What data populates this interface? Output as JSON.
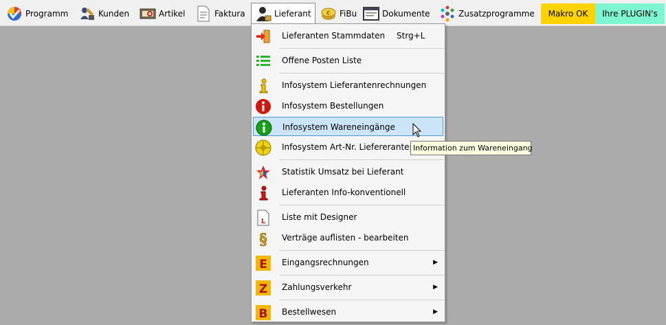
{
  "menubar": {
    "items": [
      {
        "label": "Programm",
        "icon": "colorful-checkmark-icon"
      },
      {
        "label": "Kunden",
        "icon": "customers-tools-icon"
      },
      {
        "label": "Artikel",
        "icon": "article-box-icon"
      },
      {
        "label": "Faktura",
        "icon": "invoice-document-icon"
      },
      {
        "label": "Lieferant",
        "icon": "supplier-person-icon"
      },
      {
        "label": "FiBu",
        "icon": "euro-coin-icon"
      },
      {
        "label": "Dokumente",
        "icon": "documents-screen-icon"
      },
      {
        "label": "Zusatzprogramme",
        "icon": "colorful-dots-icon"
      },
      {
        "label": "Makro OK",
        "color": "#ffd200"
      },
      {
        "label": "Ihre PLUGIN's",
        "color": "#7ff5d2"
      }
    ]
  },
  "dropdown": {
    "items": [
      {
        "label": "Lieferanten Stammdaten",
        "shortcut": "Strg+L",
        "icon": "arrow-into-door-icon"
      },
      {
        "label": "Offene Posten Liste",
        "icon": "green-list-icon"
      },
      {
        "label": "Infosystem Lieferantenrechnungen",
        "icon": "yellow-info-icon"
      },
      {
        "label": "Infosystem Bestellungen",
        "icon": "red-info-icon"
      },
      {
        "label": "Infosystem Wareneingänge",
        "icon": "green-info-icon"
      },
      {
        "label": "Infosystem Art-Nr. Liefereranten",
        "icon": "yellow-target-icon"
      },
      {
        "label": "Statistik Umsatz bei Lieferant",
        "icon": "star-chart-icon"
      },
      {
        "label": "Lieferanten Info-konventionell",
        "icon": "red-info-icon"
      },
      {
        "label": "Liste mit Designer",
        "icon": "document-l-icon"
      },
      {
        "label": "Verträge auflisten - bearbeiten",
        "icon": "paragraph-sign-icon"
      },
      {
        "label": "Eingangsrechnungen",
        "icon": "letter-e-icon",
        "arrow": "▶"
      },
      {
        "label": "Zahlungsverkehr",
        "icon": "letter-z-icon",
        "arrow": "▶"
      },
      {
        "label": "Bestellwesen",
        "icon": "letter-b-icon",
        "arrow": "▶"
      }
    ]
  },
  "tooltip": {
    "text": "Information zum Wareneingang"
  }
}
